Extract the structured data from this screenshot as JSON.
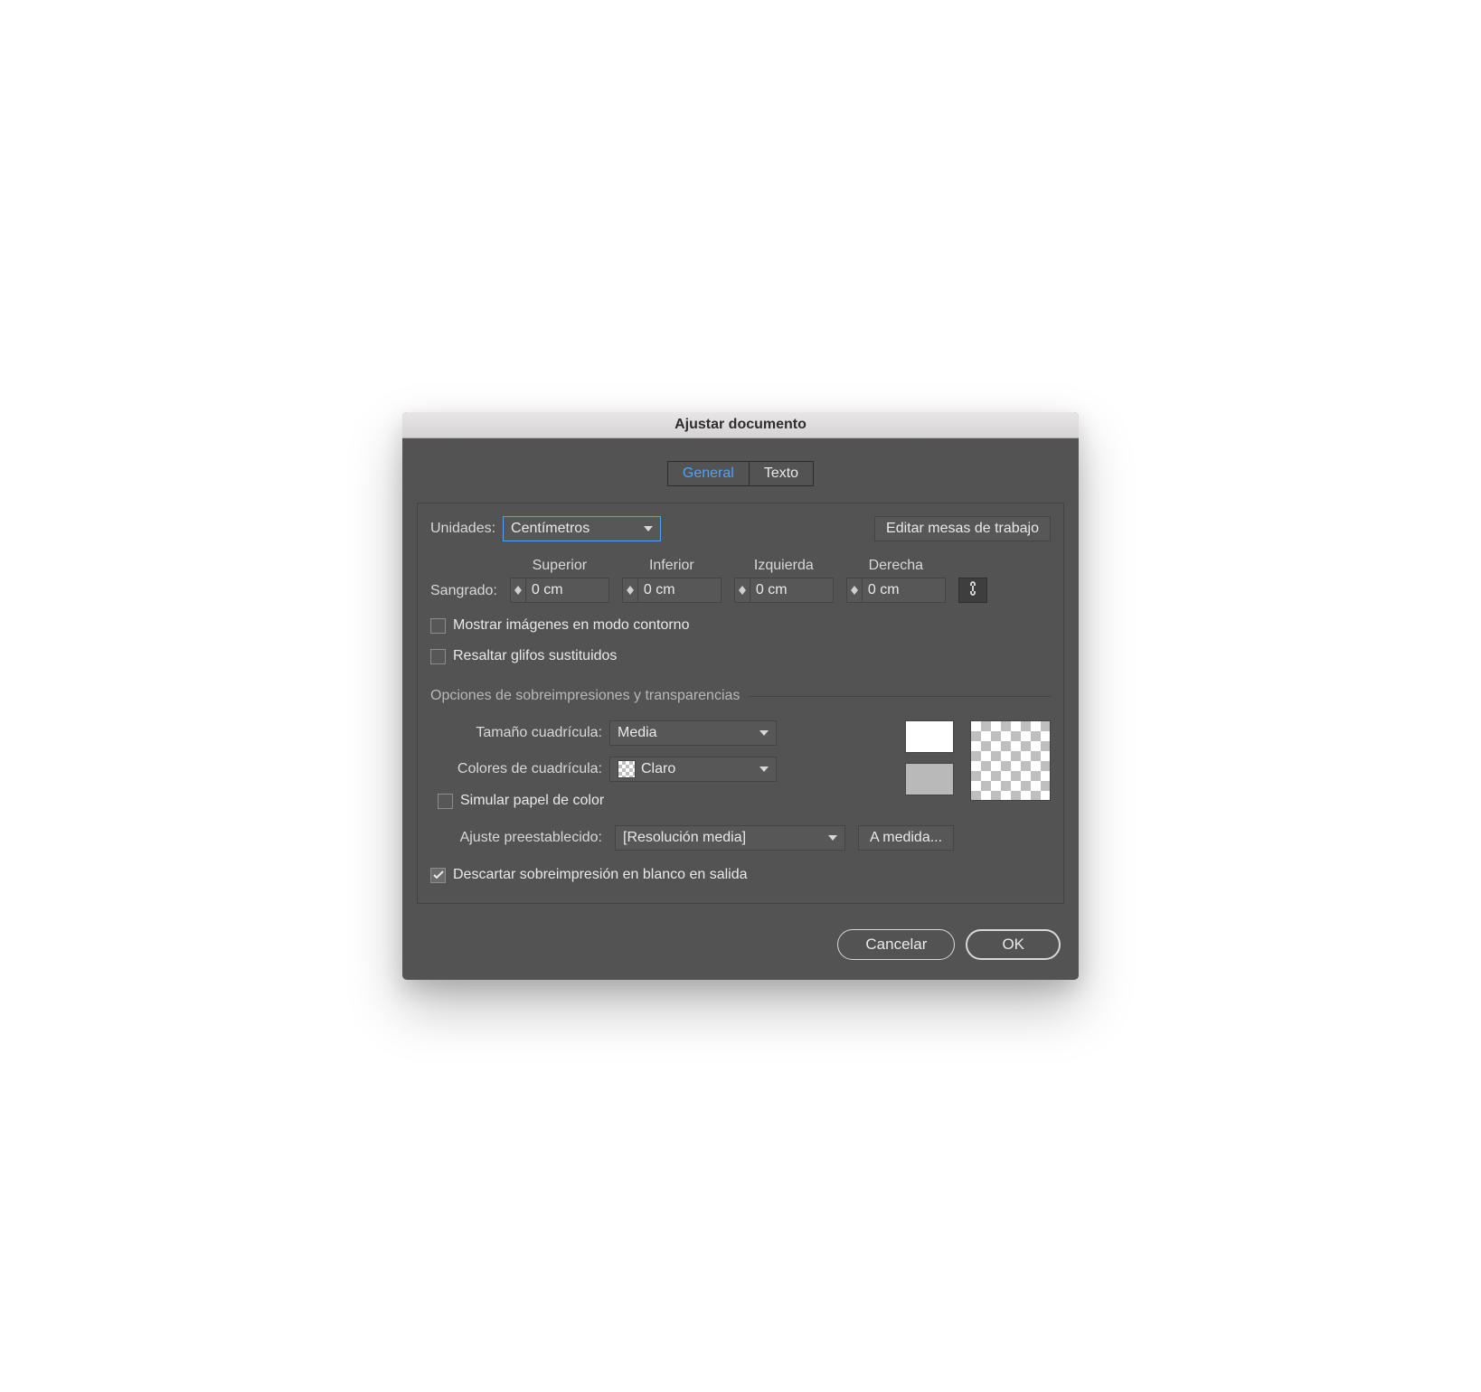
{
  "window_title": "Ajustar documento",
  "tabs": {
    "general": "General",
    "text": "Texto"
  },
  "units": {
    "label": "Unidades:",
    "value": "Centímetros"
  },
  "edit_artboards": "Editar mesas de trabajo",
  "bleed": {
    "label": "Sangrado:",
    "top": {
      "label": "Superior",
      "value": "0 cm"
    },
    "bottom": {
      "label": "Inferior",
      "value": "0 cm"
    },
    "left": {
      "label": "Izquierda",
      "value": "0 cm"
    },
    "right": {
      "label": "Derecha",
      "value": "0 cm"
    }
  },
  "checks": {
    "outline": "Mostrar imágenes en modo contorno",
    "glyphs": "Resaltar glifos sustituidos",
    "simulate": "Simular papel de color",
    "discard": "Descartar sobreimpresión en blanco en salida"
  },
  "section_overprint": "Opciones de sobreimpresiones y transparencias",
  "grid_size": {
    "label": "Tamaño cuadrícula:",
    "value": "Media"
  },
  "grid_colors": {
    "label": "Colores de cuadrícula:",
    "value": "Claro"
  },
  "preset": {
    "label": "Ajuste preestablecido:",
    "value": "[Resolución media]"
  },
  "custom_btn": "A medida...",
  "buttons": {
    "cancel": "Cancelar",
    "ok": "OK"
  }
}
